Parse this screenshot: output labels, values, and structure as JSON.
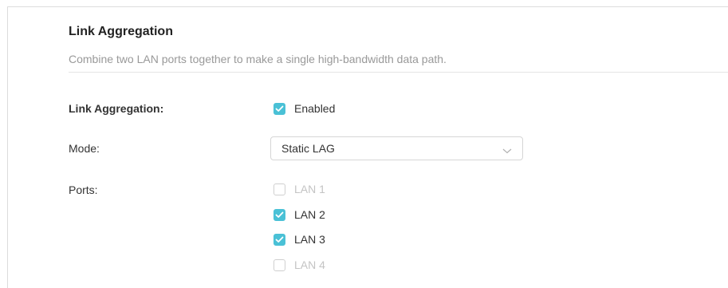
{
  "section": {
    "title": "Link Aggregation",
    "description": "Combine two LAN ports together to make a single high-bandwidth data path."
  },
  "link_aggregation": {
    "label": "Link Aggregation:",
    "checkbox_label": "Enabled",
    "checked": true
  },
  "mode": {
    "label": "Mode:",
    "selected": "Static LAG",
    "icon": "chevron-down-icon"
  },
  "ports": {
    "label": "Ports:",
    "items": [
      {
        "label": "LAN 1",
        "checked": false,
        "disabled": true
      },
      {
        "label": "LAN 2",
        "checked": true,
        "disabled": false
      },
      {
        "label": "LAN 3",
        "checked": true,
        "disabled": false
      },
      {
        "label": "LAN 4",
        "checked": false,
        "disabled": true
      }
    ]
  },
  "colors": {
    "accent": "#4ac1d6",
    "disabled_text": "#c4c4c4",
    "description_text": "#999999"
  }
}
